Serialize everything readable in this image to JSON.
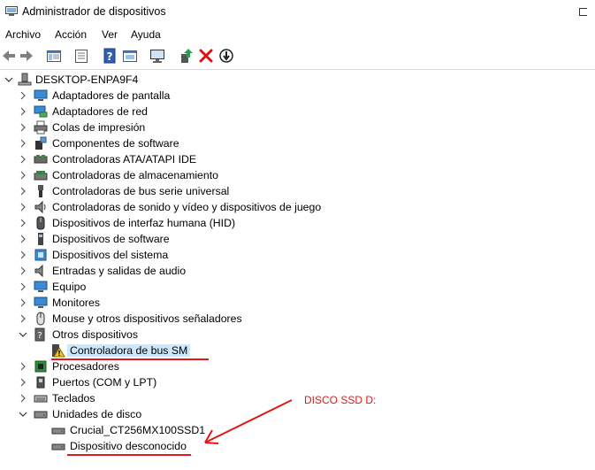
{
  "window": {
    "title": "Administrador de dispositivos"
  },
  "menu": [
    "Archivo",
    "Acción",
    "Ver",
    "Ayuda"
  ],
  "toolbar": {
    "buttons": [
      "back-arrow-icon",
      "forward-arrow-icon",
      "show-hide-tree-icon",
      "properties-icon",
      "help-icon",
      "action-icon",
      "monitor-scan-icon",
      "update-driver-icon",
      "uninstall-icon",
      "disable-icon"
    ]
  },
  "tree": {
    "root": "DESKTOP-ENPA9F4",
    "categories": [
      {
        "label": "Adaptadores de pantalla",
        "icon": "display-adapter-icon"
      },
      {
        "label": "Adaptadores de red",
        "icon": "network-adapter-icon"
      },
      {
        "label": "Colas de impresión",
        "icon": "printer-icon"
      },
      {
        "label": "Componentes de software",
        "icon": "software-component-icon"
      },
      {
        "label": "Controladoras ATA/ATAPI IDE",
        "icon": "ide-controller-icon"
      },
      {
        "label": "Controladoras de almacenamiento",
        "icon": "storage-controller-icon"
      },
      {
        "label": "Controladoras de bus serie universal",
        "icon": "usb-icon"
      },
      {
        "label": "Controladoras de sonido y vídeo y dispositivos de juego",
        "icon": "speaker-icon"
      },
      {
        "label": "Dispositivos de interfaz humana (HID)",
        "icon": "hid-icon"
      },
      {
        "label": "Dispositivos de software",
        "icon": "software-device-icon"
      },
      {
        "label": "Dispositivos del sistema",
        "icon": "system-device-icon"
      },
      {
        "label": "Entradas y salidas de audio",
        "icon": "audio-icon"
      },
      {
        "label": "Equipo",
        "icon": "computer-icon"
      },
      {
        "label": "Monitores",
        "icon": "monitor-icon"
      },
      {
        "label": "Mouse y otros dispositivos señaladores",
        "icon": "mouse-icon"
      },
      {
        "label": "Otros dispositivos",
        "icon": "other-devices-icon",
        "expanded": true,
        "children": [
          {
            "label": "Controladora de bus SM",
            "icon": "warning-device-icon",
            "selected": true
          }
        ]
      },
      {
        "label": "Procesadores",
        "icon": "processor-icon"
      },
      {
        "label": "Puertos (COM y LPT)",
        "icon": "port-icon"
      },
      {
        "label": "Teclados",
        "icon": "keyboard-icon"
      },
      {
        "label": "Unidades de disco",
        "icon": "disk-drive-icon",
        "expanded": true,
        "children": [
          {
            "label": "Crucial_CT256MX100SSD1",
            "icon": "disk-icon"
          },
          {
            "label": "Dispositivo desconocido",
            "icon": "disk-icon"
          }
        ]
      }
    ]
  },
  "annotation": {
    "text": "DISCO SSD D:",
    "color": "#e01818"
  },
  "colors": {
    "selection": "#cce8ff",
    "annotation": "#e01818"
  }
}
